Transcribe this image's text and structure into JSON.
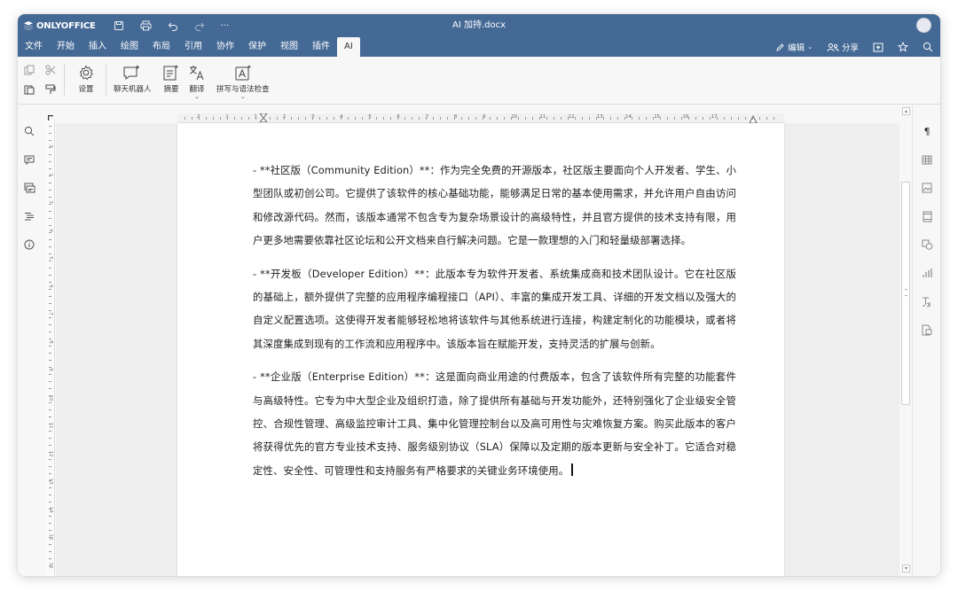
{
  "app": {
    "brand": "ONLYOFFICE",
    "document_title": "AI 加持.docx",
    "accent_color": "#446995"
  },
  "quick_access": {
    "save_icon": "save-icon",
    "print_icon": "print-icon",
    "undo_icon": "undo-icon",
    "redo_icon": "redo-icon",
    "more_label": "···"
  },
  "menu": {
    "tabs": [
      "文件",
      "开始",
      "插入",
      "绘图",
      "布局",
      "引用",
      "协作",
      "保护",
      "视图",
      "插件",
      "AI"
    ],
    "active_tab": "AI",
    "edit_label": "编辑",
    "share_label": "分享"
  },
  "ribbon": {
    "settings_label": "设置",
    "chatbot_label": "聊天机器人",
    "summary_label": "摘要",
    "translate_label": "翻译",
    "spellcheck_label": "拼写与语法检查"
  },
  "ruler": {
    "h_labels": [
      "2",
      "1",
      "1",
      "2",
      "3",
      "4",
      "5",
      "6",
      "7",
      "8",
      "9",
      "10",
      "11",
      "12",
      "13",
      "14",
      "15",
      "16",
      "17"
    ],
    "v_labels": [
      "2",
      "1",
      "3",
      "4",
      "5",
      "6",
      "7",
      "8",
      "9",
      "10",
      "11",
      "12",
      "13",
      "14",
      "15",
      "16",
      "17"
    ]
  },
  "document": {
    "paragraphs": [
      "- **社区版（Community Edition）**：作为完全免费的开源版本，社区版主要面向个人开发者、学生、小型团队或初创公司。它提供了该软件的核心基础功能，能够满足日常的基本使用需求，并允许用户自由访问和修改源代码。然而，该版本通常不包含专为复杂场景设计的高级特性，并且官方提供的技术支持有限，用户更多地需要依靠社区论坛和公开文档来自行解决问题。它是一款理想的入门和轻量级部署选择。",
      "- **开发板（Developer Edition）**：此版本专为软件开发者、系统集成商和技术团队设计。它在社区版的基础上，额外提供了完整的应用程序编程接口（API）、丰富的集成开发工具、详细的开发文档以及强大的自定义配置选项。这使得开发者能够轻松地将该软件与其他系统进行连接，构建定制化的功能模块，或者将其深度集成到现有的工作流和应用程序中。该版本旨在赋能开发，支持灵活的扩展与创新。",
      "- **企业版（Enterprise Edition）**：这是面向商业用途的付费版本，包含了该软件所有完整的功能套件与高级特性。它专为中大型企业及组织打造，除了提供所有基础与开发功能外，还特别强化了企业级安全管控、合规性管理、高级监控审计工具、集中化管理控制台以及高可用性与灾难恢复方案。购买此版本的客户将获得优先的官方专业技术支持、服务级别协议（SLA）保障以及定期的版本更新与安全补丁。它适合对稳定性、安全性、可管理性和支持服务有严格要求的关键业务环境使用。"
    ]
  }
}
